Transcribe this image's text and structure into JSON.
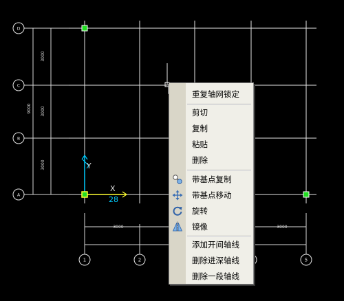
{
  "drawing": {
    "axis_labels_left": [
      "D",
      "C",
      "B",
      "A"
    ],
    "axis_labels_bottom": [
      "1",
      "2",
      "3",
      "4",
      "5"
    ],
    "dim_left_segments": [
      "3000",
      "3000",
      "3000"
    ],
    "dim_left_total": "9000",
    "dim_bottom_left": "3000",
    "dim_bottom_right": "3000",
    "ucs": {
      "x_label": "X",
      "y_label": "Y",
      "z_label": "28"
    },
    "colors": {
      "grid": "#e6e6e6",
      "dim": "#d8d8d8",
      "grip": "#22dd22",
      "ucs_x": "#ffff33",
      "ucs_y": "#00ccff",
      "menu_bg": "#f0efe8",
      "menu_strip": "#d9d6c8"
    }
  },
  "context_menu": {
    "items": [
      {
        "label": "重复轴网锁定",
        "icon": ""
      },
      {
        "label": "剪切",
        "icon": ""
      },
      {
        "label": "复制",
        "icon": ""
      },
      {
        "label": "粘贴",
        "icon": ""
      },
      {
        "label": "删除",
        "icon": ""
      },
      {
        "label": "带基点复制",
        "icon": "copy-with-basepoint-icon"
      },
      {
        "label": "带基点移动",
        "icon": "move-icon"
      },
      {
        "label": "旋转",
        "icon": "rotate-icon"
      },
      {
        "label": "镜像",
        "icon": "mirror-icon"
      },
      {
        "label": "添加开间轴线",
        "icon": ""
      },
      {
        "label": "删除进深轴线",
        "icon": ""
      },
      {
        "label": "删除一段轴线",
        "icon": ""
      }
    ]
  }
}
